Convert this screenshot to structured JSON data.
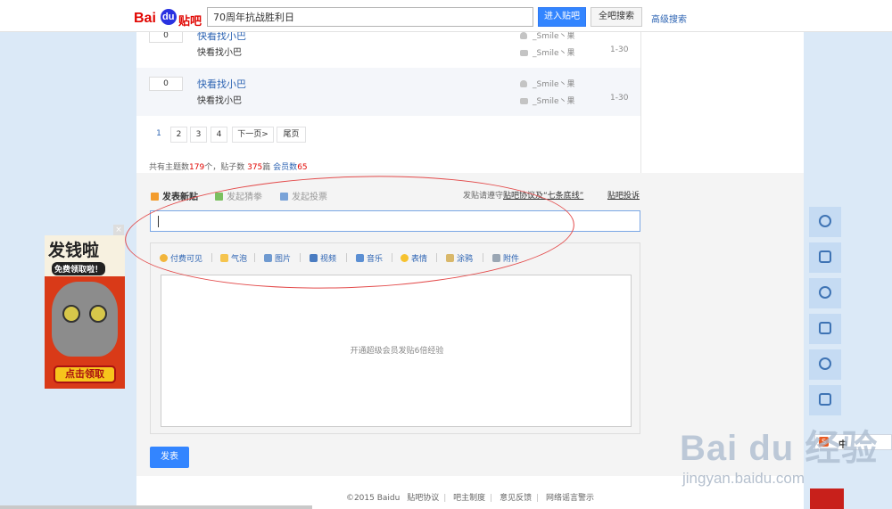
{
  "header": {
    "logo_text": "Baidu贴吧",
    "search_value": "70周年抗战胜利日",
    "enter_button": "进入贴吧",
    "all_search_button": "全吧搜索",
    "advanced_search": "高级搜索"
  },
  "threads": [
    {
      "reply_count": "0",
      "title": "快看找小巴",
      "abstract": "快看找小巴",
      "author": "_Smile丶果",
      "last_reply": "_Smile丶果",
      "time": "1-30"
    },
    {
      "reply_count": "0",
      "title": "快看找小巴",
      "abstract": "快看找小巴",
      "author": "_Smile丶果",
      "last_reply": "_Smile丶果",
      "time": "1-30"
    }
  ],
  "pager": {
    "pages": [
      "1",
      "2",
      "3",
      "4"
    ],
    "next": "下一页>",
    "last": "尾页"
  },
  "stats": {
    "topic_label": "共有主题数",
    "topic_count": "179",
    "topic_unit": "个，贴子数",
    "post_count": "375",
    "post_unit": "篇",
    "member_label": "会员数",
    "member_count": "65"
  },
  "post_tabs": {
    "new_post": "发表新贴",
    "guess": "发起猜拳",
    "vote": "发起投票",
    "notice_prefix": "发贴请遵守",
    "notice_link": "贴吧协议及“七条底线”",
    "report": "贴吧投诉"
  },
  "toolbar": {
    "paid": "付费可见",
    "bubble": "气泡",
    "image": "图片",
    "video": "视频",
    "music": "音乐",
    "emoji": "表情",
    "doodle": "涂鸦",
    "attachment": "附件"
  },
  "editor": {
    "placeholder": "开通超级会员发贴6倍经验"
  },
  "submit": "发表",
  "footer": {
    "copyright": "©2015 Baidu",
    "links": [
      "贴吧协议",
      "吧主制度",
      "意见反馈",
      "网络谣言警示"
    ]
  },
  "ad": {
    "title": "发钱啦",
    "subtitle": "免费领取啦！",
    "button": "点击领取",
    "close": "×"
  },
  "ime": {
    "logo": "S",
    "text": "中"
  },
  "watermark": {
    "main": "Bai du 经验",
    "sub": "jingyan.baidu.com"
  },
  "icons": [
    "location-icon",
    "edit-icon",
    "refresh-icon",
    "share-icon",
    "heart-icon",
    "flask-icon"
  ]
}
